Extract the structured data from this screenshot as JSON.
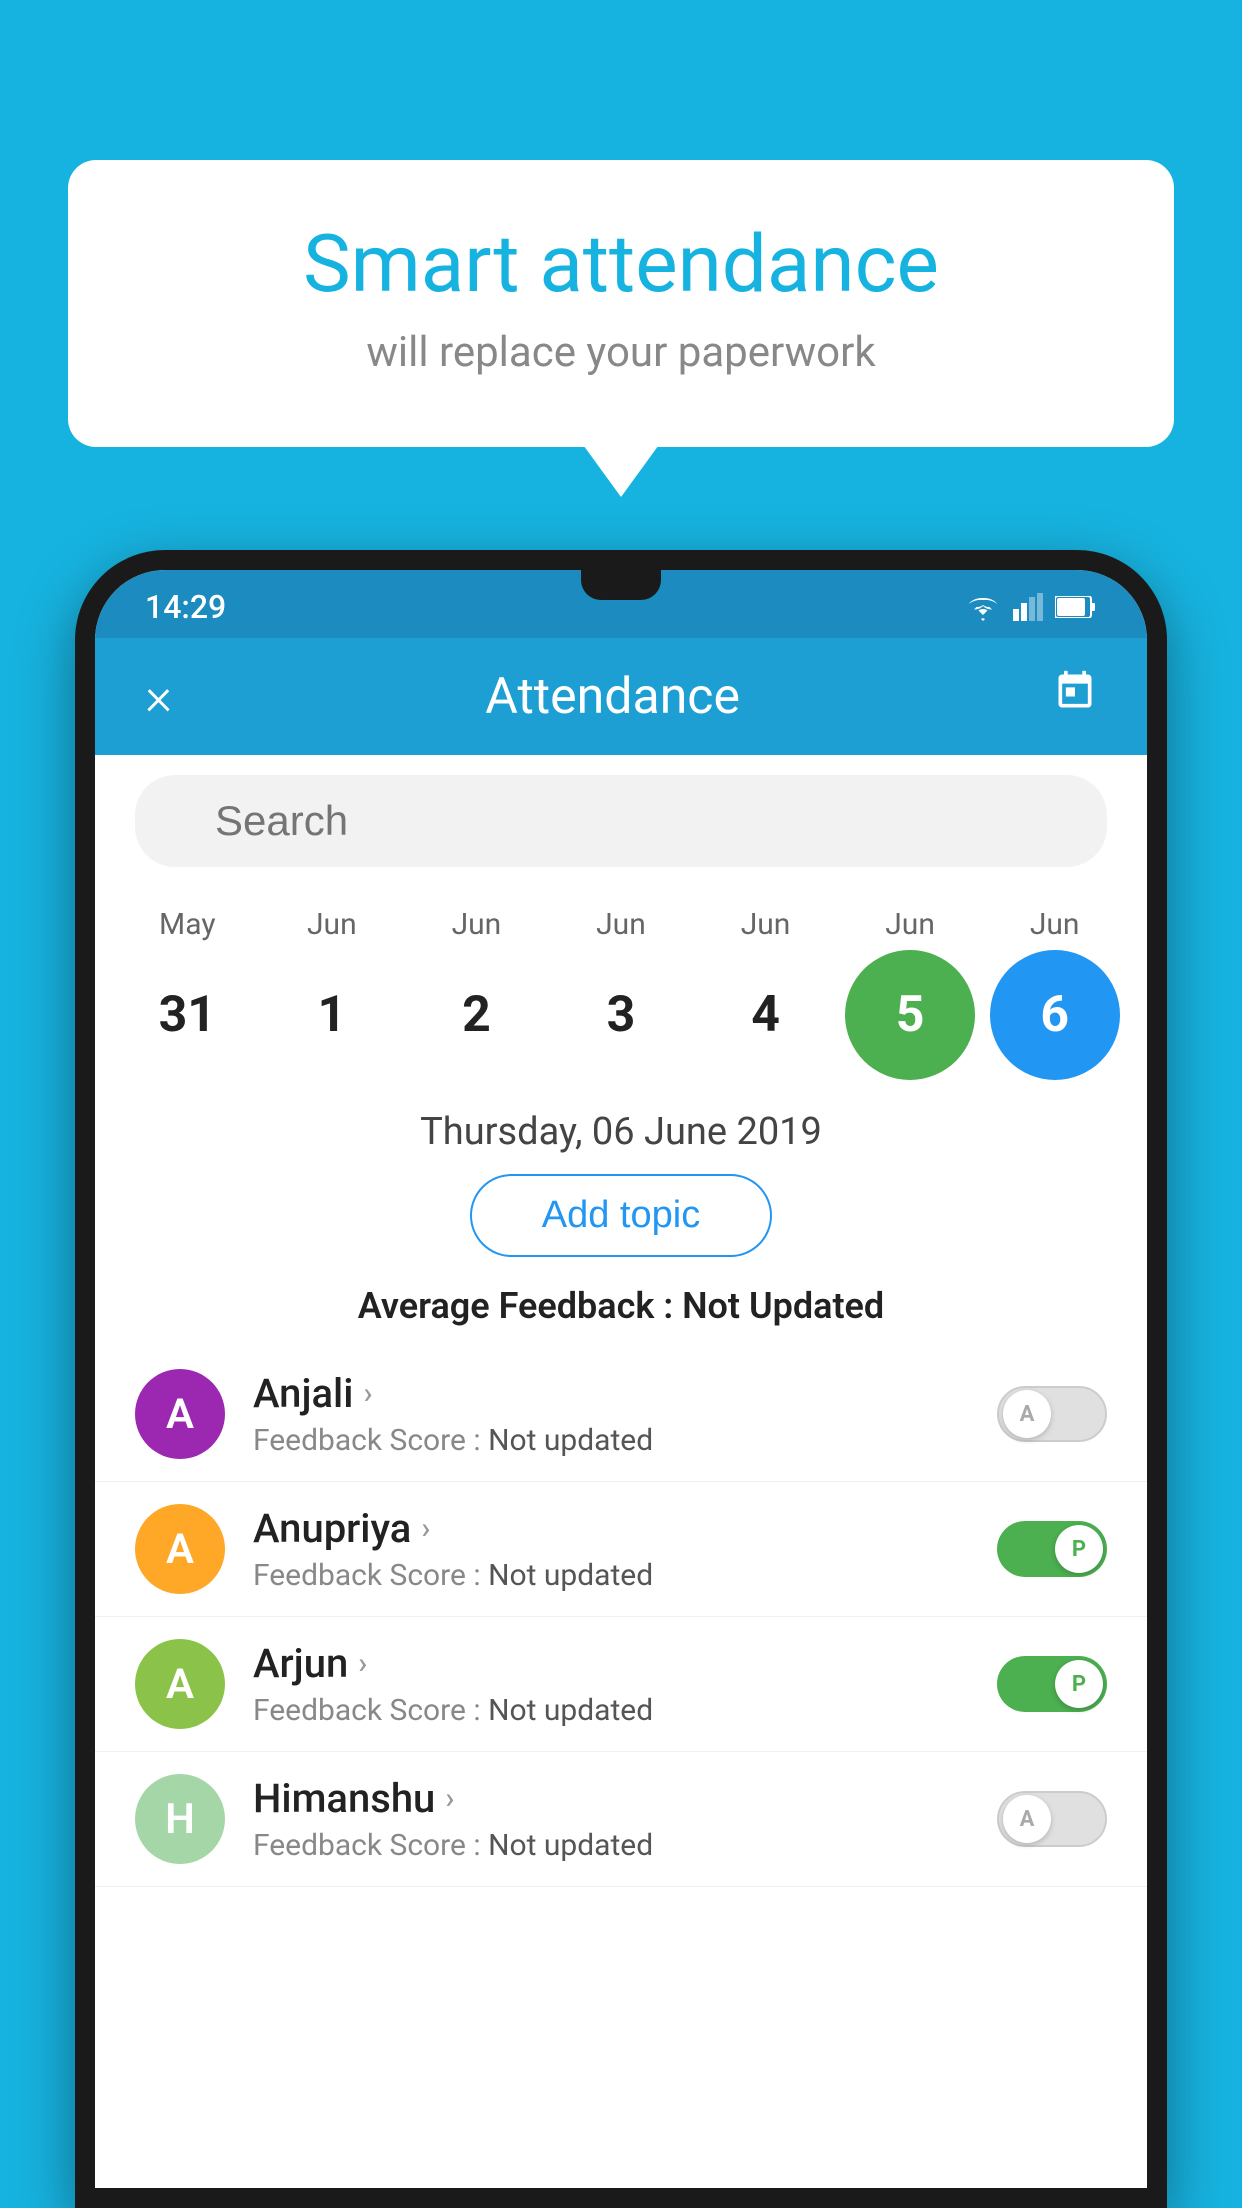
{
  "background_color": "#17b3e0",
  "bubble": {
    "title": "Smart attendance",
    "subtitle": "will replace your paperwork"
  },
  "status_bar": {
    "time": "14:29"
  },
  "header": {
    "title": "Attendance",
    "close_label": "×",
    "calendar_label": "📅"
  },
  "search": {
    "placeholder": "Search"
  },
  "calendar": {
    "months": [
      "May",
      "Jun",
      "Jun",
      "Jun",
      "Jun",
      "Jun",
      "Jun"
    ],
    "days": [
      "31",
      "1",
      "2",
      "3",
      "4",
      "5",
      "6"
    ],
    "today_index": 5,
    "selected_index": 6
  },
  "date_display": "Thursday, 06 June 2019",
  "add_topic_label": "Add topic",
  "avg_feedback": {
    "label": "Average Feedback :",
    "value": "Not Updated"
  },
  "students": [
    {
      "name": "Anjali",
      "avatar_letter": "A",
      "avatar_color": "#9c27b0",
      "feedback_label": "Feedback Score :",
      "feedback_value": "Not updated",
      "toggle": "off",
      "toggle_letter": "A"
    },
    {
      "name": "Anupriya",
      "avatar_letter": "A",
      "avatar_color": "#ffa726",
      "feedback_label": "Feedback Score :",
      "feedback_value": "Not updated",
      "toggle": "on",
      "toggle_letter": "P"
    },
    {
      "name": "Arjun",
      "avatar_letter": "A",
      "avatar_color": "#8bc34a",
      "feedback_label": "Feedback Score :",
      "feedback_value": "Not updated",
      "toggle": "on",
      "toggle_letter": "P"
    },
    {
      "name": "Himanshu",
      "avatar_letter": "H",
      "avatar_color": "#a5d6a7",
      "feedback_label": "Feedback Score :",
      "feedback_value": "Not updated",
      "toggle": "off",
      "toggle_letter": "A"
    }
  ]
}
